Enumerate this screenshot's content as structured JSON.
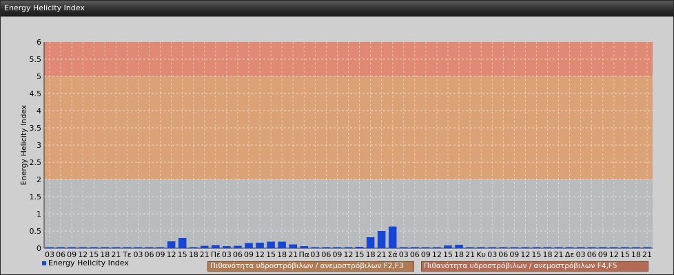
{
  "window": {
    "title": "Energy Helicity Index"
  },
  "chart_data": {
    "type": "bar",
    "ylabel": "Energy Helicity Index",
    "ylim": [
      0,
      6
    ],
    "yticks": [
      "0",
      "0.5",
      "1",
      "1.5",
      "2",
      "2.5",
      "3",
      "3.5",
      "4",
      "4.5",
      "5",
      "5.5",
      "6"
    ],
    "bands": [
      {
        "from": 0,
        "to": 2,
        "color": "#b9bcbe"
      },
      {
        "from": 2,
        "to": 5,
        "color": "#dba277"
      },
      {
        "from": 5,
        "to": 6,
        "color": "#e08a75"
      }
    ],
    "categories": [
      "03",
      "06",
      "09",
      "12",
      "15",
      "18",
      "21",
      "Τε",
      "03",
      "06",
      "09",
      "12",
      "15",
      "18",
      "21",
      "Πέ",
      "03",
      "06",
      "09",
      "12",
      "15",
      "18",
      "21",
      "Πα",
      "03",
      "06",
      "09",
      "12",
      "15",
      "18",
      "21",
      "Σά",
      "03",
      "06",
      "09",
      "12",
      "15",
      "18",
      "21",
      "Κυ",
      "03",
      "06",
      "09",
      "12",
      "15",
      "18",
      "21",
      "Δε",
      "03",
      "06",
      "09",
      "12",
      "15",
      "18",
      "21"
    ],
    "series": [
      {
        "name": "Energy Helicity Index",
        "color": "#1546d6",
        "values": [
          0.01,
          0.01,
          0.01,
          0.01,
          0.01,
          0.02,
          0.01,
          0.01,
          0.01,
          0.01,
          0.01,
          0.2,
          0.3,
          0.02,
          0.07,
          0.09,
          0.06,
          0.07,
          0.15,
          0.16,
          0.19,
          0.19,
          0.11,
          0.06,
          0.01,
          0.01,
          0.01,
          0.02,
          0.04,
          0.32,
          0.5,
          0.63,
          0.03,
          0.02,
          0.01,
          0.02,
          0.08,
          0.1,
          0.01,
          0.01,
          0.01,
          0.01,
          0.01,
          0.01,
          0.01,
          0.01,
          0.01,
          0.01,
          0.01,
          0.01,
          0.01,
          0.01,
          0.01,
          0.01,
          0.01
        ]
      }
    ],
    "legend": {
      "series_label": "Energy Helicity Index",
      "zones": [
        {
          "label": "Πιθανότητα υδροστρόβιλων / ανεμοστρόβιλων F2,F3",
          "color": "#b07a55"
        },
        {
          "label": "Πιθανότητα υδροστρόβιλων / ανεμοστρόβιλων F4,F5",
          "color": "#b56a55"
        }
      ]
    }
  }
}
